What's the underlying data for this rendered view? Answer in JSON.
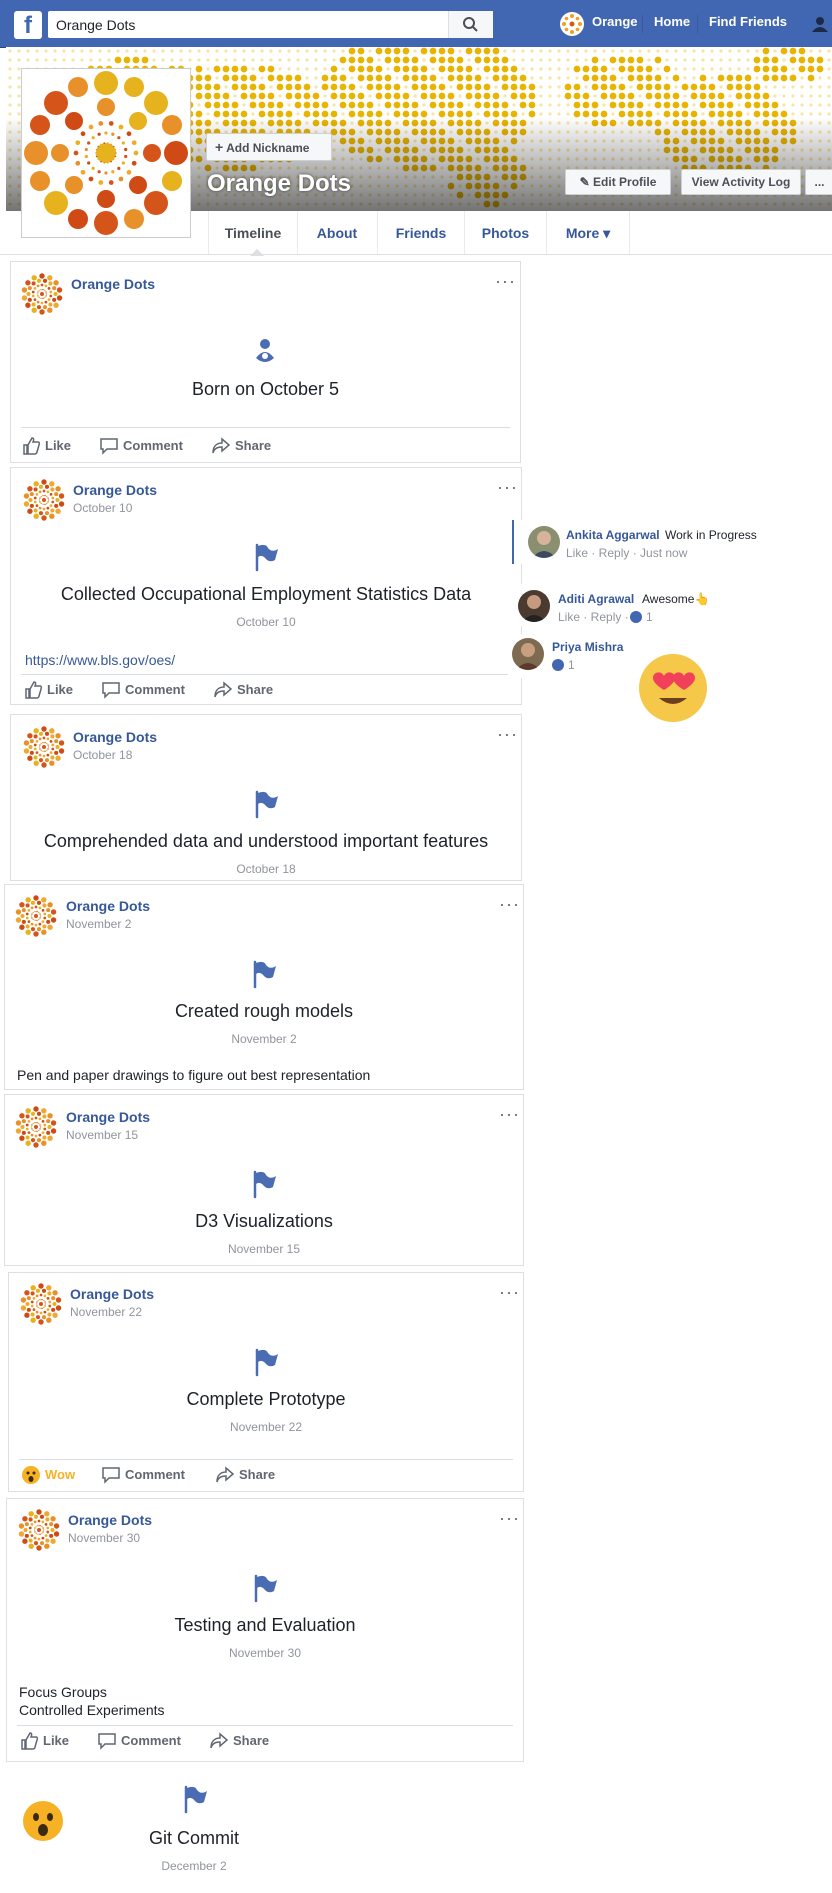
{
  "topbar": {
    "search_value": "Orange Dots",
    "user_label": "Orange",
    "home_label": "Home",
    "find_friends_label": "Find Friends"
  },
  "profile": {
    "name": "Orange Dots",
    "add_nickname_label": "Add Nickname",
    "edit_profile_label": "Edit Profile",
    "view_activity_label": "View Activity Log",
    "more_dots": "..."
  },
  "tabs": [
    "Timeline",
    "About",
    "Friends",
    "Photos",
    "More ▾"
  ],
  "actions": {
    "like": "Like",
    "comment": "Comment",
    "share": "Share",
    "wow": "Wow",
    "more": "···"
  },
  "posts": [
    {
      "author": "Orange Dots",
      "date": "",
      "title": "Born on October 5",
      "event_date": "",
      "text": ""
    },
    {
      "author": "Orange Dots",
      "date": "October 10",
      "title": "Collected Occupational Employment Statistics Data",
      "event_date": "October 10",
      "link": "https://www.bls.gov/oes/"
    },
    {
      "author": "Orange Dots",
      "date": "October 18",
      "title": "Comprehended data and understood important features",
      "event_date": "October 18"
    },
    {
      "author": "Orange Dots",
      "date": "November 2",
      "title": "Created rough models",
      "event_date": "November 2",
      "text": "Pen and paper drawings to figure out best representation"
    },
    {
      "author": "Orange Dots",
      "date": "November 15",
      "title": "D3 Visualizations",
      "event_date": "November 15"
    },
    {
      "author": "Orange Dots",
      "date": "November 22",
      "title": "Complete Prototype",
      "event_date": "November 22"
    },
    {
      "author": "Orange Dots",
      "date": "November 30",
      "title": "Testing and Evaluation",
      "event_date": "November 30",
      "text1": "Focus Groups",
      "text2": "Controlled Experiments"
    },
    {
      "title": "Git Commit",
      "event_date": "December 2"
    }
  ],
  "comments": [
    {
      "name": "Ankita Aggarwal",
      "text": "Work in Progress",
      "meta": "Like · Reply · Just now"
    },
    {
      "name": "Aditi Agrawal",
      "text": "Awesome👆",
      "meta": "Like · Reply · ",
      "count": "1"
    },
    {
      "name": "Priya Mishra",
      "text": "",
      "count": "1"
    }
  ],
  "colors": {
    "brand": "#4267b2",
    "link": "#365899",
    "dots": "#e8b400"
  }
}
